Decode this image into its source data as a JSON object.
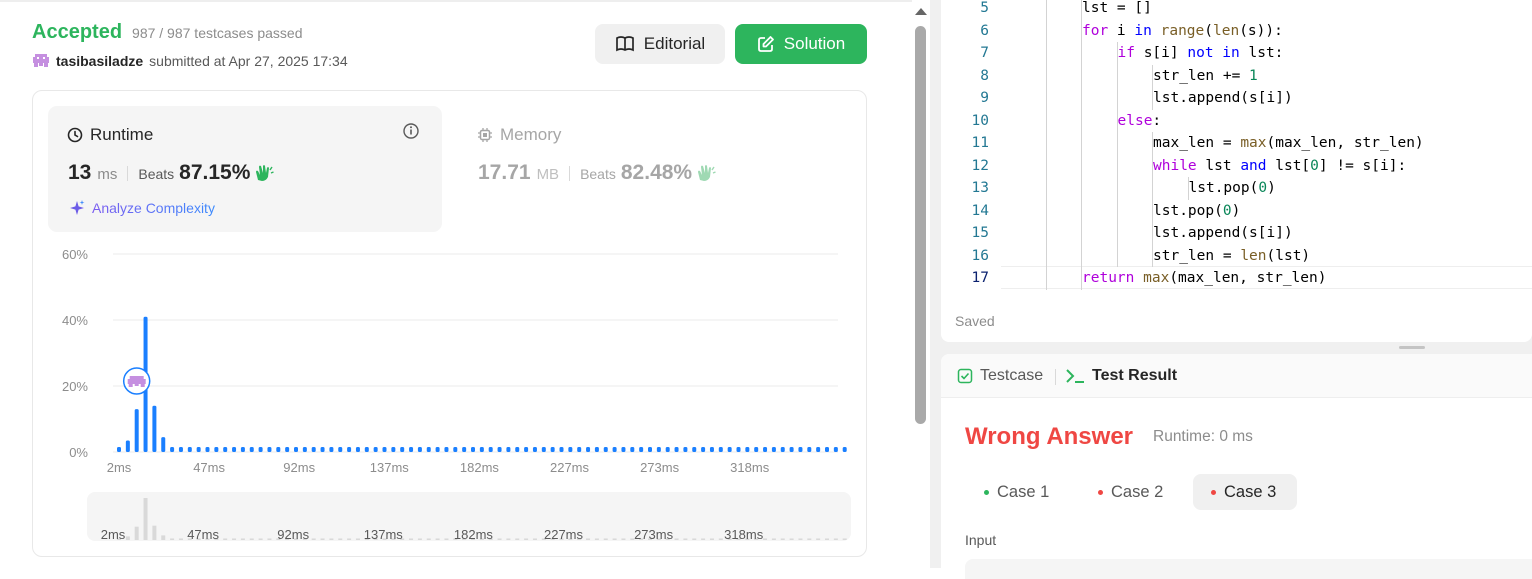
{
  "submission": {
    "status": "Accepted",
    "tests_passed": "987 / 987 testcases passed",
    "username": "tasibasiladze",
    "submitted_text": "submitted at Apr 27, 2025 17:34"
  },
  "buttons": {
    "editorial": "Editorial",
    "solution": "Solution"
  },
  "runtime": {
    "title": "Runtime",
    "value": "13",
    "unit": "ms",
    "beats_label": "Beats",
    "beats_value": "87.15%",
    "analyze": "Analyze Complexity"
  },
  "memory": {
    "title": "Memory",
    "value": "17.71",
    "unit": "MB",
    "beats_label": "Beats",
    "beats_value": "82.48%"
  },
  "colors": {
    "accepted": "#2db55d",
    "bar": "#1a7fff",
    "wrong": "#ef4743",
    "avatar": "#c58fe0"
  },
  "chart_data": {
    "type": "bar",
    "y_ticks": [
      "60%",
      "40%",
      "20%",
      "0%"
    ],
    "ylim": [
      0,
      60
    ],
    "x_ticks": [
      "2ms",
      "47ms",
      "92ms",
      "137ms",
      "182ms",
      "227ms",
      "273ms",
      "318ms"
    ],
    "values": [
      1.5,
      3.5,
      13,
      41,
      14,
      4.5,
      1.5,
      1.5,
      1.5,
      1.5,
      1.5,
      1.5,
      1.5,
      1.5,
      1.5,
      1.5,
      1.5,
      1.5,
      1.5,
      1.5,
      1.5,
      1.5,
      1.5,
      1.5,
      1.5,
      1.5,
      1.5,
      1.5,
      1.5,
      1.5,
      1.5,
      1.5,
      1.5,
      1.5,
      1.5,
      1.5,
      1.5,
      1.5,
      1.5,
      1.5,
      1.5,
      1.5,
      1.5,
      1.5,
      1.5,
      1.5,
      1.5,
      1.5,
      1.5,
      1.5,
      1.5,
      1.5,
      1.5,
      1.5,
      1.5,
      1.5,
      1.5,
      1.5,
      1.5,
      1.5,
      1.5,
      1.5,
      1.5,
      1.5,
      1.5,
      1.5,
      1.5,
      1.5,
      1.5,
      1.5,
      1.5,
      1.5,
      1.5,
      1.5,
      1.5,
      1.5,
      1.5,
      1.5,
      1.5,
      1.5,
      1.5,
      1.5,
      1.5
    ],
    "highlight_bar_index": 2,
    "grid": true
  },
  "code": {
    "lines": [
      {
        "n": "5",
        "indent": 3,
        "html": "lst = []"
      },
      {
        "n": "6",
        "indent": 3,
        "html": "<span class=\"ctl\">for</span> i <span class=\"kw\">in</span> <span class=\"fn\">range</span>(<span class=\"fn\">len</span>(s)):"
      },
      {
        "n": "7",
        "indent": 4,
        "html": "<span class=\"ctl\">if</span> s[i] <span class=\"kw\">not</span> <span class=\"kw\">in</span> lst:"
      },
      {
        "n": "8",
        "indent": 5,
        "html": "str_len += <span class=\"num\">1</span>"
      },
      {
        "n": "9",
        "indent": 5,
        "html": "lst.append(s[i])"
      },
      {
        "n": "10",
        "indent": 4,
        "html": "<span class=\"ctl\">else</span>:"
      },
      {
        "n": "11",
        "indent": 5,
        "html": "max_len = <span class=\"fn\">max</span>(max_len, str_len)"
      },
      {
        "n": "12",
        "indent": 5,
        "html": "<span class=\"ctl\">while</span> lst <span class=\"kw\">and</span> lst[<span class=\"num\">0</span>] != s[i]:"
      },
      {
        "n": "13",
        "indent": 6,
        "html": "lst.pop(<span class=\"num\">0</span>)"
      },
      {
        "n": "14",
        "indent": 5,
        "html": "lst.pop(<span class=\"num\">0</span>)"
      },
      {
        "n": "15",
        "indent": 5,
        "html": "lst.append(s[i])"
      },
      {
        "n": "16",
        "indent": 5,
        "html": "str_len = <span class=\"fn\">len</span>(lst)"
      },
      {
        "n": "17",
        "indent": 3,
        "html": "<span class=\"ctl\">return</span> <span class=\"fn\">max</span>(max_len, str_len)"
      }
    ],
    "saved": "Saved"
  },
  "result": {
    "tab_testcase": "Testcase",
    "tab_result": "Test Result",
    "verdict": "Wrong Answer",
    "runtime": "Runtime: 0 ms",
    "cases": [
      "Case 1",
      "Case 2",
      "Case 3"
    ],
    "input_label": "Input"
  }
}
